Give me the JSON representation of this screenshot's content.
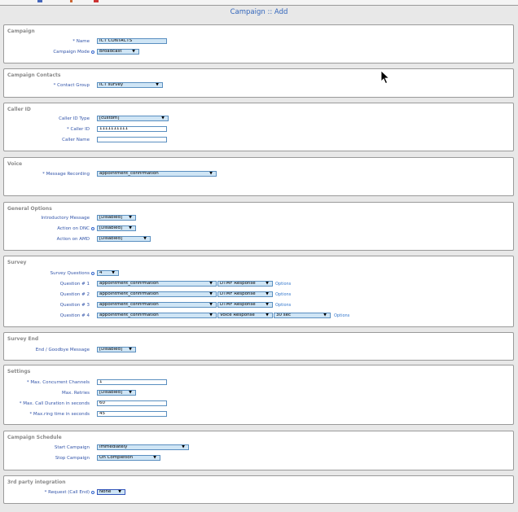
{
  "page": {
    "title": "Campaign :: Add"
  },
  "campaign": {
    "section_title": "Campaign",
    "name_label": "* Name",
    "name_value": "ICT CONTACTS",
    "mode_label": "Campaign Mode",
    "mode_value": "Broadcast"
  },
  "contacts": {
    "section_title": "Campaign Contacts",
    "group_label": "* Contact Group",
    "group_value": "ICT survey"
  },
  "callerid": {
    "section_title": "Caller ID",
    "type_label": "Caller ID Type",
    "type_value": "[custom]",
    "id_label": "* Caller ID",
    "id_value": "1111111111",
    "name_label": "Caller Name",
    "name_value": ""
  },
  "voice": {
    "section_title": "Voice",
    "recording_label": "* Message Recording",
    "recording_value": "appointment_confirmation"
  },
  "general": {
    "section_title": "General Options",
    "intro_label": "Introductory Message",
    "intro_value": "[Disabled]",
    "dnc_label": "Action on DNC",
    "dnc_value": "[Disabled]",
    "amd_label": "Action on AMD",
    "amd_value": "[Disabled]"
  },
  "survey": {
    "section_title": "Survey",
    "count_label": "Survey Questions",
    "count_value": "4",
    "options_label": "Options",
    "questions": [
      {
        "label": "Question # 1",
        "recording": "appointment_confirmation",
        "type": "DTMF Response"
      },
      {
        "label": "Question # 2",
        "recording": "appointment_confirmation",
        "type": "DTMF Response"
      },
      {
        "label": "Question # 3",
        "recording": "appointment_confirmation",
        "type": "DTMF Response"
      },
      {
        "label": "Question # 4",
        "recording": "appointment_confirmation",
        "type": "Voice Response",
        "duration": "30 sec"
      }
    ]
  },
  "survey_end": {
    "section_title": "Survey End",
    "goodbye_label": "End / Goodbye Message",
    "goodbye_value": "[Disabled]"
  },
  "settings": {
    "section_title": "Settings",
    "channels_label": "* Max. Concurrent Channels",
    "channels_value": "1",
    "retries_label": "Max. Retries",
    "retries_value": "[Disabled]",
    "duration_label": "* Max. Call Duration in seconds",
    "duration_value": "60",
    "ring_label": "* Max.ring time in seconds",
    "ring_value": "45"
  },
  "schedule": {
    "section_title": "Campaign Schedule",
    "start_label": "Start Campaign",
    "start_value": "Immediately",
    "stop_label": "Stop Campaign",
    "stop_value": "On Completion"
  },
  "third_party": {
    "section_title": "3rd party integration",
    "request_label": "* Request (Call End)",
    "request_value": "None"
  },
  "colors": {
    "accent": "#3366bb",
    "field_bg": "#cfe5f5",
    "required": "#cc2222"
  }
}
